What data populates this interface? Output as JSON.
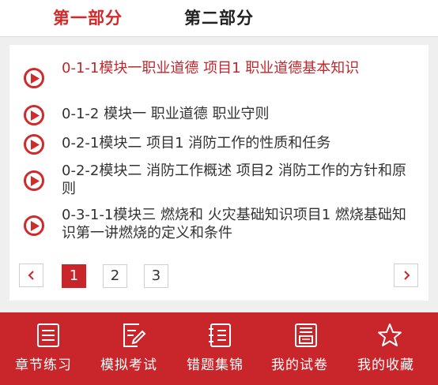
{
  "tabs": [
    {
      "label": "第一部分",
      "active": true
    },
    {
      "label": "第二部分",
      "active": false
    }
  ],
  "items": [
    {
      "title": "0-1-1模块一职业道德 项目1 职业道德基本知识",
      "active": true
    },
    {
      "title": "0-1-2 模块一 职业道德 职业守则",
      "active": false
    },
    {
      "title": "0-2-1模块二 项目1 消防工作的性质和任务",
      "active": false
    },
    {
      "title": "0-2-2模块二 消防工作概述 项目2 消防工作的方针和原则",
      "active": false
    },
    {
      "title": "0-3-1-1模块三 燃烧和 火灾基础知识项目1 燃烧基础知识第一讲燃烧的定义和条件",
      "active": false
    }
  ],
  "pagination": {
    "pages": [
      "1",
      "2",
      "3"
    ],
    "current": "1",
    "prev_icon": "chevron-left-icon",
    "next_icon": "chevron-right-icon"
  },
  "bottom_nav": [
    {
      "label": "章节练习",
      "icon": "list-icon"
    },
    {
      "label": "模拟考试",
      "icon": "edit-document-icon"
    },
    {
      "label": "错题集锦",
      "icon": "notebook-icon"
    },
    {
      "label": "我的试卷",
      "icon": "exam-paper-icon"
    },
    {
      "label": "我的收藏",
      "icon": "star-icon"
    }
  ],
  "colors": {
    "accent": "#c8262b",
    "active_text": "#c0272d",
    "background": "#efefef"
  }
}
